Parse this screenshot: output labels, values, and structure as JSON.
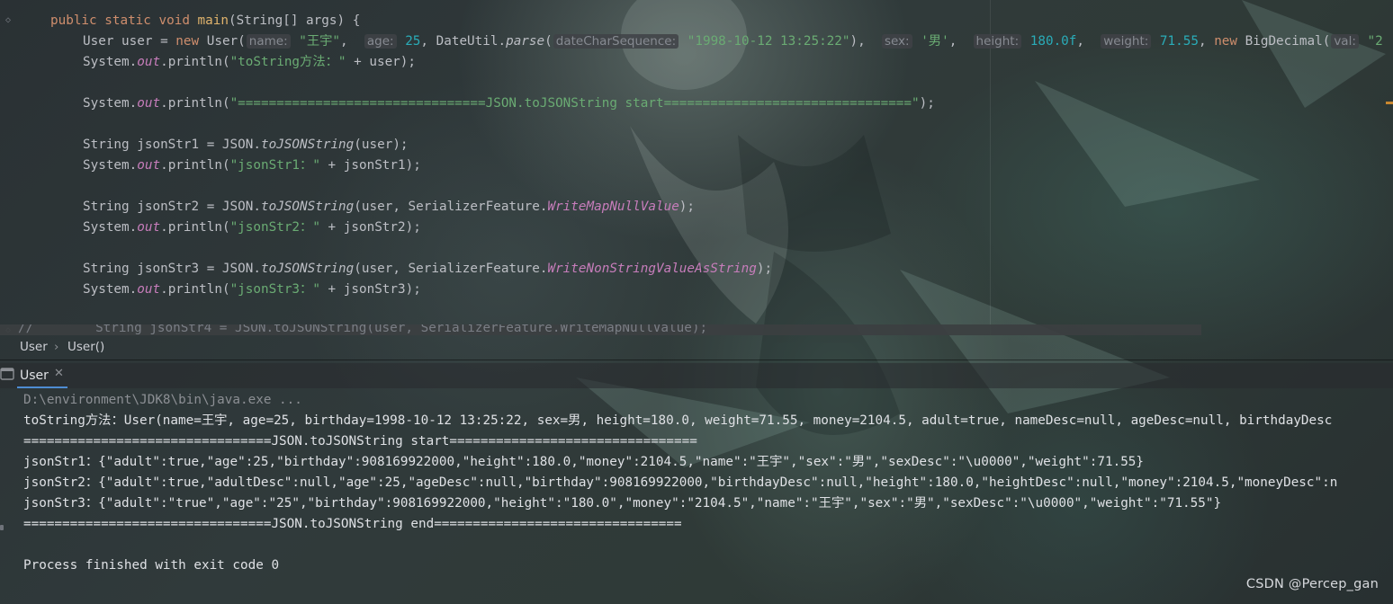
{
  "editor": {
    "lines": [
      [
        {
          "t": "public static void ",
          "c": "kw"
        },
        {
          "t": "main",
          "c": "fn"
        },
        {
          "t": "(String[] args) {",
          "c": ""
        }
      ],
      [
        {
          "t": "User user = ",
          "c": ""
        },
        {
          "t": "new ",
          "c": "kw"
        },
        {
          "t": "User(",
          "c": ""
        },
        {
          "t": "name:",
          "c": "hint"
        },
        {
          "t": " ",
          "c": ""
        },
        {
          "t": "\"王宇\"",
          "c": "str"
        },
        {
          "t": ",  ",
          "c": ""
        },
        {
          "t": "age:",
          "c": "hint"
        },
        {
          "t": " ",
          "c": ""
        },
        {
          "t": "25",
          "c": "num"
        },
        {
          "t": ", DateUtil.",
          "c": ""
        },
        {
          "t": "parse",
          "c": "stat"
        },
        {
          "t": "(",
          "c": ""
        },
        {
          "t": "dateCharSequence:",
          "c": "hint"
        },
        {
          "t": " ",
          "c": ""
        },
        {
          "t": "\"1998-10-12 13:25:22\"",
          "c": "str"
        },
        {
          "t": "),  ",
          "c": ""
        },
        {
          "t": "sex:",
          "c": "hint"
        },
        {
          "t": " ",
          "c": ""
        },
        {
          "t": "'男'",
          "c": "str"
        },
        {
          "t": ",  ",
          "c": ""
        },
        {
          "t": "height:",
          "c": "hint"
        },
        {
          "t": " ",
          "c": ""
        },
        {
          "t": "180.0f",
          "c": "num"
        },
        {
          "t": ",  ",
          "c": ""
        },
        {
          "t": "weight:",
          "c": "hint"
        },
        {
          "t": " ",
          "c": ""
        },
        {
          "t": "71.55",
          "c": "num"
        },
        {
          "t": ", ",
          "c": ""
        },
        {
          "t": "new ",
          "c": "kw"
        },
        {
          "t": "BigDecimal(",
          "c": ""
        },
        {
          "t": "val:",
          "c": "hint"
        },
        {
          "t": " ",
          "c": ""
        },
        {
          "t": "\"2",
          "c": "str"
        }
      ],
      [
        {
          "t": "System.",
          "c": ""
        },
        {
          "t": "out",
          "c": "fld"
        },
        {
          "t": ".println(",
          "c": ""
        },
        {
          "t": "\"toString方法：\"",
          "c": "str"
        },
        {
          "t": " + user);",
          "c": ""
        }
      ],
      [],
      [
        {
          "t": "System.",
          "c": ""
        },
        {
          "t": "out",
          "c": "fld"
        },
        {
          "t": ".println(",
          "c": ""
        },
        {
          "t": "\"================================JSON.toJSONString start================================\"",
          "c": "str"
        },
        {
          "t": ");",
          "c": ""
        }
      ],
      [],
      [
        {
          "t": "String jsonStr1 = JSON.",
          "c": ""
        },
        {
          "t": "toJSONString",
          "c": "stat"
        },
        {
          "t": "(user);",
          "c": ""
        }
      ],
      [
        {
          "t": "System.",
          "c": ""
        },
        {
          "t": "out",
          "c": "fld"
        },
        {
          "t": ".println(",
          "c": ""
        },
        {
          "t": "\"jsonStr1：\"",
          "c": "str"
        },
        {
          "t": " + jsonStr1);",
          "c": ""
        }
      ],
      [],
      [
        {
          "t": "String jsonStr2 = JSON.",
          "c": ""
        },
        {
          "t": "toJSONString",
          "c": "stat"
        },
        {
          "t": "(user, SerializerFeature.",
          "c": ""
        },
        {
          "t": "WriteMapNullValue",
          "c": "cnst"
        },
        {
          "t": ");",
          "c": ""
        }
      ],
      [
        {
          "t": "System.",
          "c": ""
        },
        {
          "t": "out",
          "c": "fld"
        },
        {
          "t": ".println(",
          "c": ""
        },
        {
          "t": "\"jsonStr2：\"",
          "c": "str"
        },
        {
          "t": " + jsonStr2);",
          "c": ""
        }
      ],
      [],
      [
        {
          "t": "String jsonStr3 = JSON.",
          "c": ""
        },
        {
          "t": "toJSONString",
          "c": "stat"
        },
        {
          "t": "(user, SerializerFeature.",
          "c": ""
        },
        {
          "t": "WriteNonStringValueAsString",
          "c": "cnst"
        },
        {
          "t": ");",
          "c": ""
        }
      ],
      [
        {
          "t": "System.",
          "c": ""
        },
        {
          "t": "out",
          "c": "fld"
        },
        {
          "t": ".println(",
          "c": ""
        },
        {
          "t": "\"jsonStr3：\"",
          "c": "str"
        },
        {
          "t": " + jsonStr3);",
          "c": ""
        }
      ]
    ],
    "commented_line": "//        String jsonStr4 = JSON.toJSONString(user, SerializerFeature.WriteMapNullValue);"
  },
  "breadcrumb": {
    "class_name": "User",
    "separator": "›",
    "method_name": "User()"
  },
  "run_panel": {
    "tab_label": "User",
    "close_glyph": "✕"
  },
  "console": {
    "lines": [
      "D:\\environment\\JDK8\\bin\\java.exe ...",
      "toString方法：User(name=王宇, age=25, birthday=1998-10-12 13:25:22, sex=男, height=180.0, weight=71.55, money=2104.5, adult=true, nameDesc=null, ageDesc=null, birthdayDesc",
      "================================JSON.toJSONString start================================",
      "jsonStr1：{\"adult\":true,\"age\":25,\"birthday\":908169922000,\"height\":180.0,\"money\":2104.5,\"name\":\"王宇\",\"sex\":\"男\",\"sexDesc\":\"\\u0000\",\"weight\":71.55}",
      "jsonStr2：{\"adult\":true,\"adultDesc\":null,\"age\":25,\"ageDesc\":null,\"birthday\":908169922000,\"birthdayDesc\":null,\"height\":180.0,\"heightDesc\":null,\"money\":2104.5,\"moneyDesc\":n",
      "jsonStr3：{\"adult\":\"true\",\"age\":\"25\",\"birthday\":908169922000,\"height\":\"180.0\",\"money\":\"2104.5\",\"name\":\"王宇\",\"sex\":\"男\",\"sexDesc\":\"\\u0000\",\"weight\":\"71.55\"}",
      "================================JSON.toJSONString end================================",
      "",
      "Process finished with exit code 0"
    ]
  },
  "watermark": "CSDN @Percep_gan",
  "icons": {
    "fold": "fold-arrow-icon",
    "run_tab": "run-tool-icon"
  },
  "colors": {
    "keyword": "#cf8e6d",
    "string": "#6aab73",
    "number": "#2aacb8",
    "field": "#c77dbb",
    "method": "#e0b36c",
    "text": "#bcbec4",
    "tab_underline": "#4e8cd3"
  }
}
